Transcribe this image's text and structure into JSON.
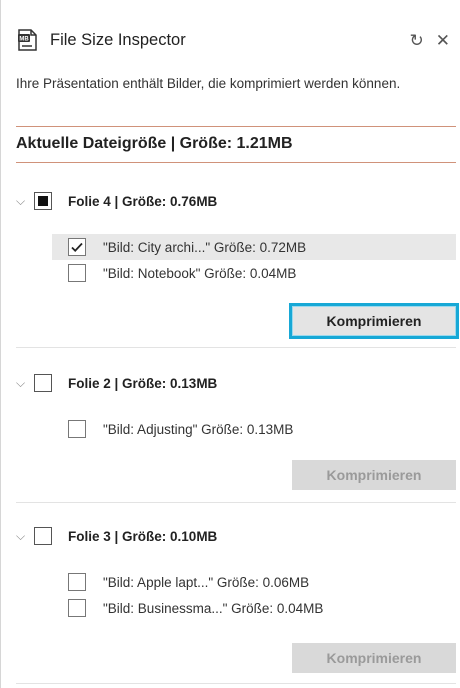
{
  "header": {
    "title": "File Size Inspector",
    "refresh_icon": "refresh-icon",
    "close_icon": "close-icon"
  },
  "description": "Ihre Präsentation enthält Bilder, die komprimiert werden können.",
  "total_size": "Aktuelle Dateigröße | Größe: 1.21MB",
  "colors": {
    "separator": "#d0927a",
    "focus_outline": "#17a8d6"
  },
  "slides": [
    {
      "title": "Folie 4 | Größe: 0.76MB",
      "checkbox_state": "indeterminate",
      "items": [
        {
          "label": "\"Bild: City archi...\" Größe: 0.72MB",
          "checked": true,
          "selected": true
        },
        {
          "label": "\"Bild: Notebook\" Größe: 0.04MB",
          "checked": false,
          "selected": false
        }
      ],
      "button_label": "Komprimieren",
      "button_enabled": true
    },
    {
      "title": "Folie 2 | Größe: 0.13MB",
      "checkbox_state": "unchecked",
      "items": [
        {
          "label": "\"Bild: Adjusting\" Größe: 0.13MB",
          "checked": false,
          "selected": false
        }
      ],
      "button_label": "Komprimieren",
      "button_enabled": false
    },
    {
      "title": "Folie 3 | Größe: 0.10MB",
      "checkbox_state": "unchecked",
      "items": [
        {
          "label": "\"Bild: Apple lapt...\" Größe: 0.06MB",
          "checked": false,
          "selected": false
        },
        {
          "label": "\"Bild: Businessma...\" Größe: 0.04MB",
          "checked": false,
          "selected": false
        }
      ],
      "button_label": "Komprimieren",
      "button_enabled": false
    }
  ]
}
